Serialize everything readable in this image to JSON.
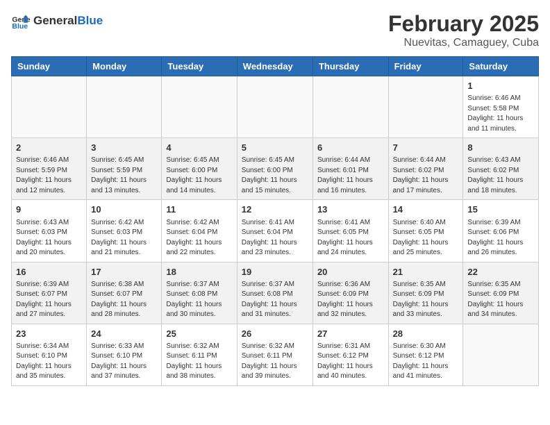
{
  "header": {
    "logo_general": "General",
    "logo_blue": "Blue",
    "month": "February 2025",
    "location": "Nuevitas, Camaguey, Cuba"
  },
  "days_of_week": [
    "Sunday",
    "Monday",
    "Tuesday",
    "Wednesday",
    "Thursday",
    "Friday",
    "Saturday"
  ],
  "weeks": [
    [
      {
        "day": "",
        "info": ""
      },
      {
        "day": "",
        "info": ""
      },
      {
        "day": "",
        "info": ""
      },
      {
        "day": "",
        "info": ""
      },
      {
        "day": "",
        "info": ""
      },
      {
        "day": "",
        "info": ""
      },
      {
        "day": "1",
        "info": "Sunrise: 6:46 AM\nSunset: 5:58 PM\nDaylight: 11 hours and 11 minutes."
      }
    ],
    [
      {
        "day": "2",
        "info": "Sunrise: 6:46 AM\nSunset: 5:59 PM\nDaylight: 11 hours and 12 minutes."
      },
      {
        "day": "3",
        "info": "Sunrise: 6:45 AM\nSunset: 5:59 PM\nDaylight: 11 hours and 13 minutes."
      },
      {
        "day": "4",
        "info": "Sunrise: 6:45 AM\nSunset: 6:00 PM\nDaylight: 11 hours and 14 minutes."
      },
      {
        "day": "5",
        "info": "Sunrise: 6:45 AM\nSunset: 6:00 PM\nDaylight: 11 hours and 15 minutes."
      },
      {
        "day": "6",
        "info": "Sunrise: 6:44 AM\nSunset: 6:01 PM\nDaylight: 11 hours and 16 minutes."
      },
      {
        "day": "7",
        "info": "Sunrise: 6:44 AM\nSunset: 6:02 PM\nDaylight: 11 hours and 17 minutes."
      },
      {
        "day": "8",
        "info": "Sunrise: 6:43 AM\nSunset: 6:02 PM\nDaylight: 11 hours and 18 minutes."
      }
    ],
    [
      {
        "day": "9",
        "info": "Sunrise: 6:43 AM\nSunset: 6:03 PM\nDaylight: 11 hours and 20 minutes."
      },
      {
        "day": "10",
        "info": "Sunrise: 6:42 AM\nSunset: 6:03 PM\nDaylight: 11 hours and 21 minutes."
      },
      {
        "day": "11",
        "info": "Sunrise: 6:42 AM\nSunset: 6:04 PM\nDaylight: 11 hours and 22 minutes."
      },
      {
        "day": "12",
        "info": "Sunrise: 6:41 AM\nSunset: 6:04 PM\nDaylight: 11 hours and 23 minutes."
      },
      {
        "day": "13",
        "info": "Sunrise: 6:41 AM\nSunset: 6:05 PM\nDaylight: 11 hours and 24 minutes."
      },
      {
        "day": "14",
        "info": "Sunrise: 6:40 AM\nSunset: 6:05 PM\nDaylight: 11 hours and 25 minutes."
      },
      {
        "day": "15",
        "info": "Sunrise: 6:39 AM\nSunset: 6:06 PM\nDaylight: 11 hours and 26 minutes."
      }
    ],
    [
      {
        "day": "16",
        "info": "Sunrise: 6:39 AM\nSunset: 6:07 PM\nDaylight: 11 hours and 27 minutes."
      },
      {
        "day": "17",
        "info": "Sunrise: 6:38 AM\nSunset: 6:07 PM\nDaylight: 11 hours and 28 minutes."
      },
      {
        "day": "18",
        "info": "Sunrise: 6:37 AM\nSunset: 6:08 PM\nDaylight: 11 hours and 30 minutes."
      },
      {
        "day": "19",
        "info": "Sunrise: 6:37 AM\nSunset: 6:08 PM\nDaylight: 11 hours and 31 minutes."
      },
      {
        "day": "20",
        "info": "Sunrise: 6:36 AM\nSunset: 6:09 PM\nDaylight: 11 hours and 32 minutes."
      },
      {
        "day": "21",
        "info": "Sunrise: 6:35 AM\nSunset: 6:09 PM\nDaylight: 11 hours and 33 minutes."
      },
      {
        "day": "22",
        "info": "Sunrise: 6:35 AM\nSunset: 6:09 PM\nDaylight: 11 hours and 34 minutes."
      }
    ],
    [
      {
        "day": "23",
        "info": "Sunrise: 6:34 AM\nSunset: 6:10 PM\nDaylight: 11 hours and 35 minutes."
      },
      {
        "day": "24",
        "info": "Sunrise: 6:33 AM\nSunset: 6:10 PM\nDaylight: 11 hours and 37 minutes."
      },
      {
        "day": "25",
        "info": "Sunrise: 6:32 AM\nSunset: 6:11 PM\nDaylight: 11 hours and 38 minutes."
      },
      {
        "day": "26",
        "info": "Sunrise: 6:32 AM\nSunset: 6:11 PM\nDaylight: 11 hours and 39 minutes."
      },
      {
        "day": "27",
        "info": "Sunrise: 6:31 AM\nSunset: 6:12 PM\nDaylight: 11 hours and 40 minutes."
      },
      {
        "day": "28",
        "info": "Sunrise: 6:30 AM\nSunset: 6:12 PM\nDaylight: 11 hours and 41 minutes."
      },
      {
        "day": "",
        "info": ""
      }
    ]
  ]
}
